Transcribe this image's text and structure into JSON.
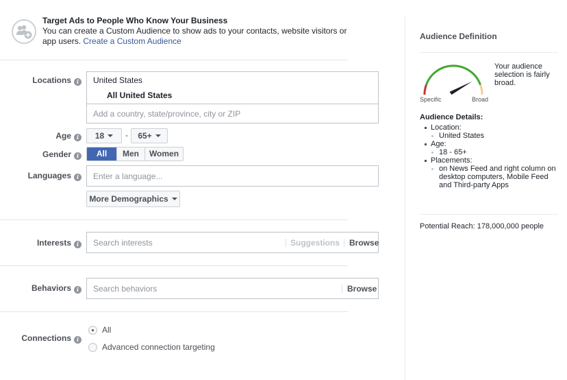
{
  "promo": {
    "icon": "custom-audience-add-icon",
    "title": "Target Ads to People Who Know Your Business",
    "body": "You can create a Custom Audience to show ads to your contacts, website visitors or app users.",
    "link": "Create a Custom Audience"
  },
  "form": {
    "locations": {
      "label": "Locations",
      "country": "United States",
      "selection": "All United States",
      "placeholder": "Add a country, state/province, city or ZIP"
    },
    "age": {
      "label": "Age",
      "min": "18",
      "max": "65+",
      "separator": "-"
    },
    "gender": {
      "label": "Gender",
      "options": [
        "All",
        "Men",
        "Women"
      ],
      "selected": "All"
    },
    "languages": {
      "label": "Languages",
      "placeholder": "Enter a language..."
    },
    "more_demographics": "More Demographics",
    "interests": {
      "label": "Interests",
      "placeholder": "Search interests",
      "suggestions": "Suggestions",
      "browse": "Browse"
    },
    "behaviors": {
      "label": "Behaviors",
      "placeholder": "Search behaviors",
      "browse": "Browse"
    },
    "connections": {
      "label": "Connections",
      "options": [
        "All",
        "Advanced connection targeting"
      ],
      "selected": "All"
    }
  },
  "sidebar": {
    "title": "Audience Definition",
    "gauge": {
      "specific_label": "Specific",
      "broad_label": "Broad",
      "level": 0.75,
      "colors": {
        "specific": "#d0312d",
        "ok": "#42a832",
        "broad": "#f7c99a",
        "needle": "#1d2129"
      }
    },
    "gauge_message": "Your audience selection is fairly broad.",
    "details_title": "Audience Details:",
    "details": [
      {
        "label": "Location:",
        "values": [
          "United States"
        ]
      },
      {
        "label": "Age:",
        "values": [
          "18 - 65+"
        ]
      },
      {
        "label": "Placements:",
        "values": [
          "on News Feed and right column on desktop computers, Mobile Feed and Third-party Apps"
        ]
      }
    ],
    "potential_reach": "Potential Reach: 178,000,000 people"
  }
}
